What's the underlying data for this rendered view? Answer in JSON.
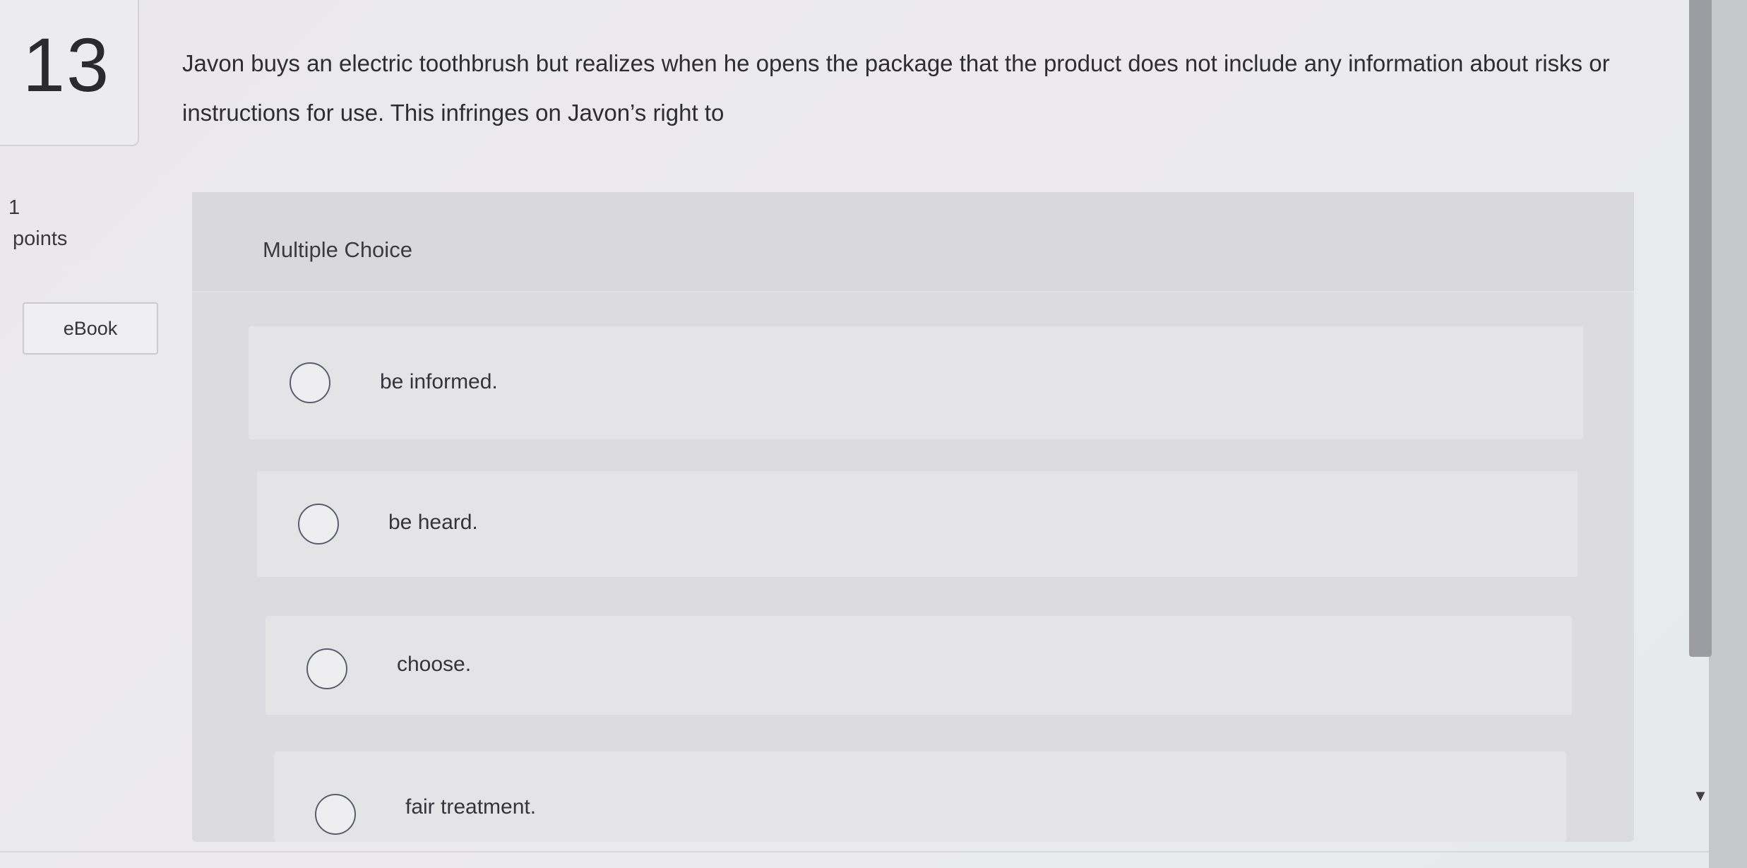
{
  "question": {
    "number": "13",
    "text": "Javon buys an electric toothbrush but realizes when he opens the package that the product does not include any information about risks or instructions for use. This infringes on Javon’s right to",
    "points_value": "1",
    "points_label": "points"
  },
  "sidebar": {
    "ebook_label": "eBook"
  },
  "multiple_choice": {
    "title": "Multiple Choice",
    "options": [
      {
        "label": "be informed."
      },
      {
        "label": "be heard."
      },
      {
        "label": "choose."
      },
      {
        "label": "fair treatment."
      }
    ]
  },
  "scrollbar": {
    "arrow_icon": "chevron-down-icon"
  }
}
